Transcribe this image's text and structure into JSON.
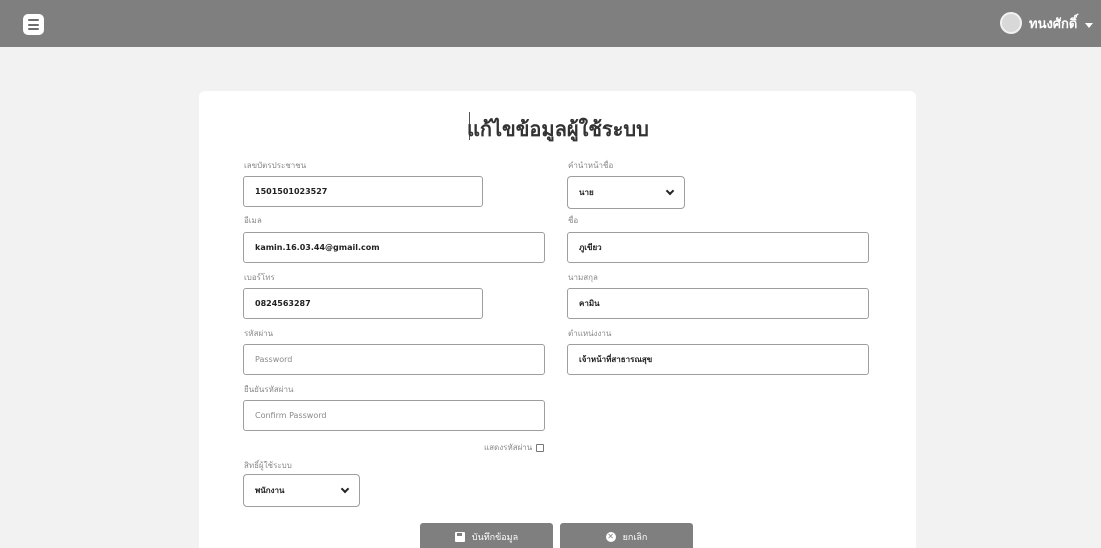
{
  "header": {
    "username": "ทนงศักดิ์"
  },
  "form": {
    "title": "แก้ไขข้อมูลผู้ใช้ระบบ",
    "id_card": {
      "label": "เลขบัตรประชาชน",
      "value": "1501501023527"
    },
    "email": {
      "label": "อีเมล",
      "value": "kamin.16.03.44@gmail.com"
    },
    "phone": {
      "label": "เบอร์โทร",
      "value": "0824563287"
    },
    "password": {
      "label": "รหัสผ่าน",
      "placeholder": "Password"
    },
    "confirm_password": {
      "label": "ยืนยันรหัสผ่าน",
      "placeholder": "Confirm Password"
    },
    "show_password_label": "แสดงรหัสผ่าน",
    "role": {
      "label": "สิทธิ์ผู้ใช้ระบบ",
      "value": "พนักงาน"
    },
    "prefix": {
      "label": "คำนำหน้าชื่อ",
      "value": "นาย"
    },
    "first_name": {
      "label": "ชื่อ",
      "value": "ภูเขียว"
    },
    "last_name": {
      "label": "นามสกุล",
      "value": "คามิน"
    },
    "position": {
      "label": "ตำแหน่งงาน",
      "value": "เจ้าหน้าที่สาธารณสุข"
    },
    "save_label": "บันทึกข้อมูล",
    "cancel_label": "ยกเลิก"
  }
}
